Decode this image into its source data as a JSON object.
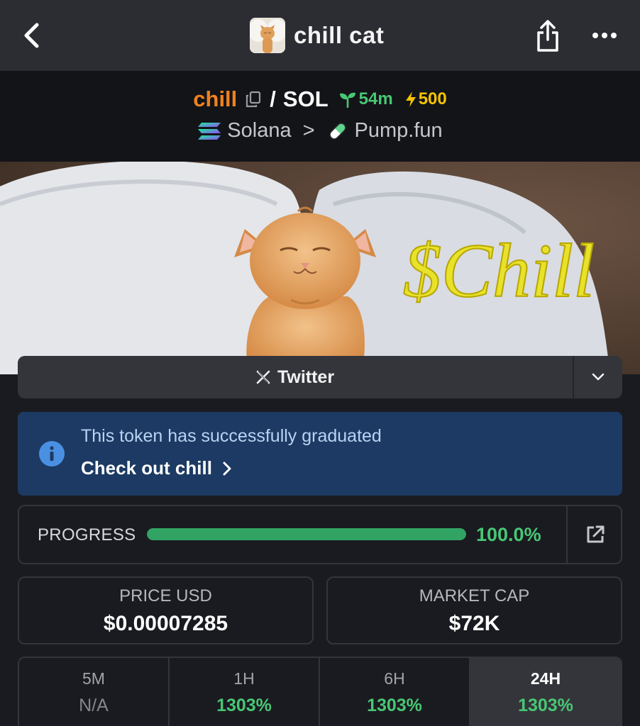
{
  "header": {
    "title": "chill cat",
    "icons": {
      "back": "chevron-left-icon",
      "share": "share-icon",
      "more": "more-horizontal-icon"
    }
  },
  "pair": {
    "base": "chill",
    "separator": "/",
    "quote": "SOL",
    "age": "54m",
    "boosts": "500"
  },
  "chain": {
    "network": "Solana",
    "separator": ">",
    "dex": "Pump.fun"
  },
  "banner": {
    "text": "$Chill"
  },
  "social": {
    "twitter_label": "Twitter"
  },
  "alert": {
    "message": "This token has successfully graduated",
    "link": "Check out chill"
  },
  "progress": {
    "label": "PROGRESS",
    "value_text": "100.0%",
    "fraction": 1.0
  },
  "stats": {
    "price": {
      "label": "PRICE USD",
      "value": "$0.00007285"
    },
    "market_cap": {
      "label": "MARKET CAP",
      "value": "$72K"
    }
  },
  "timeframes": [
    {
      "label": "5M",
      "value": "N/A"
    },
    {
      "label": "1H",
      "value": "1303%"
    },
    {
      "label": "6H",
      "value": "1303%"
    },
    {
      "label": "24H",
      "value": "1303%"
    }
  ],
  "colors": {
    "accent_orange": "#f0821e",
    "positive_green": "#48c774",
    "boost_yellow": "#f5c400",
    "alert_bg": "#1c3a63",
    "banner_text": "#e8e22a"
  }
}
